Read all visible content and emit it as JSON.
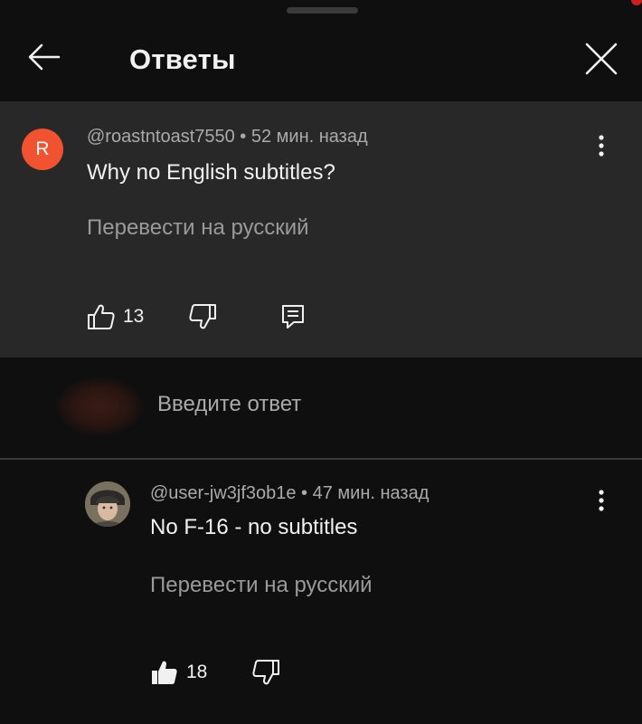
{
  "header": {
    "title": "Ответы",
    "back_icon": "arrow-left-icon",
    "close_icon": "close-icon"
  },
  "parent_comment": {
    "avatar_letter": "R",
    "avatar_color": "#f1522f",
    "meta": "@roastntoast7550 • 52 мин. назад",
    "text": "Why no English subtitles?",
    "translate": "Перевести на русский",
    "likes": "13"
  },
  "reply_input": {
    "placeholder": "Введите ответ"
  },
  "reply_comment": {
    "meta": "@user-jw3jf3ob1e • 47 мин. назад",
    "text": "No F-16 - no subtitles",
    "translate": "Перевести на русский",
    "likes": "18"
  },
  "colors": {
    "background": "#0f0f0f",
    "highlight": "#282828",
    "text_primary": "#f1f1f1",
    "text_secondary": "#aaaaaa"
  }
}
